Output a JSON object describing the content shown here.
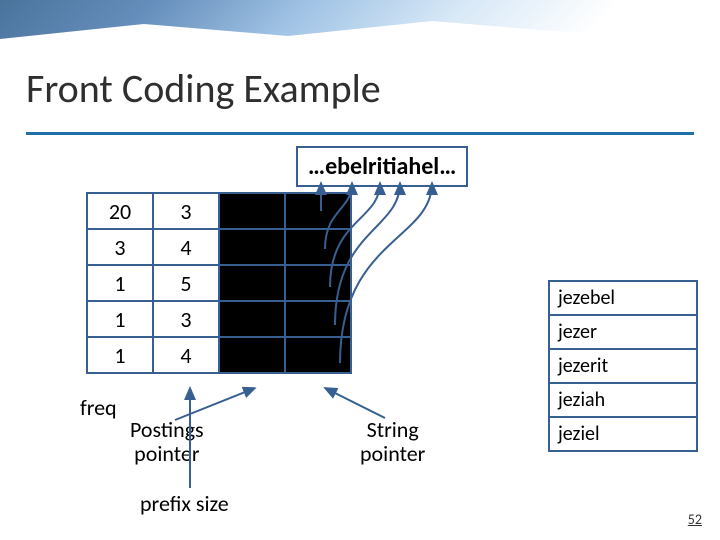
{
  "title": "Front Coding Example",
  "encoded_string": "…ebelritiahel…",
  "table": {
    "rows": [
      {
        "freq": "20",
        "prefix": "3"
      },
      {
        "freq": "3",
        "prefix": "4"
      },
      {
        "freq": "1",
        "prefix": "5"
      },
      {
        "freq": "1",
        "prefix": "3"
      },
      {
        "freq": "1",
        "prefix": "4"
      }
    ]
  },
  "labels": {
    "freq": "freq",
    "postings_l1": "Postings",
    "postings_l2": "pointer",
    "string_l1": "String",
    "string_l2": "pointer",
    "prefix_size": "prefix size"
  },
  "words": [
    "jezebel",
    "jezer",
    "jezerit",
    "jeziah",
    "jeziel"
  ],
  "page_number": "52"
}
